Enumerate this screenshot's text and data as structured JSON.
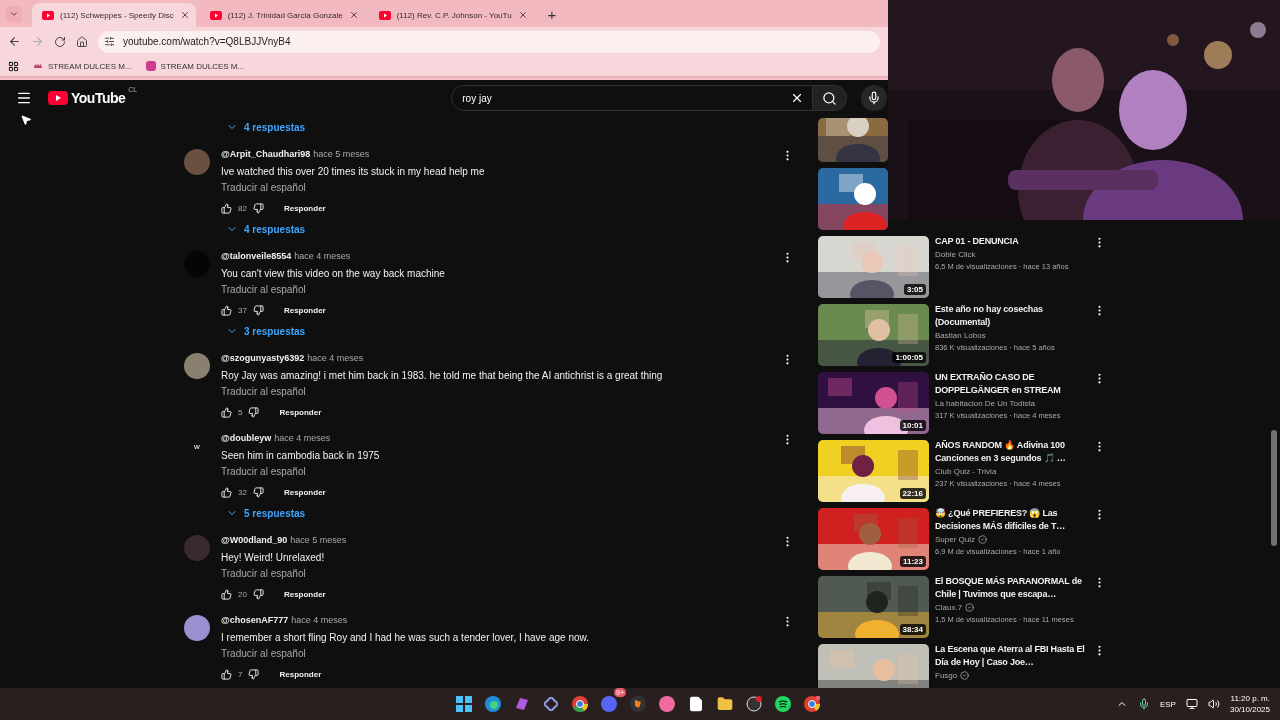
{
  "browser": {
    "tabs": [
      {
        "title": "(112) Schweppes - Speedy Disc",
        "selected": true
      },
      {
        "title": "(112) J. Trinidad Garcia Gonzale",
        "selected": false
      },
      {
        "title": "(112) Rev. C.P. Johnson - YouTu",
        "selected": false
      }
    ],
    "new_tab": "+",
    "url": "youtube.com/watch?v=Q8LBJJVnyB4",
    "bookmarks": [
      "STREAM DULCES M...",
      "STREAM DULCES M..."
    ]
  },
  "header": {
    "logo": "YouTube",
    "country": "CL",
    "search": {
      "value": "roy jay"
    }
  },
  "comments": {
    "top_replies": "4 respuestas",
    "items": [
      {
        "author": "@Arpit_Chaudhari98",
        "time": "hace 5 meses",
        "text": "Ive watched this over 20 times its stuck in my head help me",
        "translate": "Traducir al español",
        "likes": "82",
        "reply": "Responder",
        "replies": "4 respuestas"
      },
      {
        "author": "@talonveile8554",
        "time": "hace 4 meses",
        "text": "You can't view this video on the way back machine",
        "translate": "Traducir al español",
        "likes": "37",
        "reply": "Responder",
        "replies": "3 respuestas"
      },
      {
        "author": "@szogunyasty6392",
        "time": "hace 4 meses",
        "text": "Roy Jay was amazing! i met him back in 1983. he told me that being the AI antichrist is a great thing",
        "translate": "Traducir al español",
        "likes": "5",
        "reply": "Responder"
      },
      {
        "author": "@doubleyw",
        "avatar_letter": "w",
        "time": "hace 4 meses",
        "text": "Seen him in cambodia back in 1975",
        "translate": "Traducir al español",
        "likes": "32",
        "reply": "Responder",
        "replies": "5 respuestas"
      },
      {
        "author": "@W00dland_90",
        "time": "hace 5 meses",
        "text": "Hey! Weird! Unrelaxed!",
        "translate": "Traducir al español",
        "likes": "20",
        "reply": "Responder"
      },
      {
        "author": "@chosenAF777",
        "time": "hace 4 meses",
        "text": "I remember a short fling Roy and I had he was such a tender lover, I have age now.",
        "translate": "Traducir al español",
        "likes": "7",
        "reply": "Responder"
      }
    ]
  },
  "sidebar": {
    "items": [
      {
        "kind": "partial"
      },
      {
        "kind": "partial"
      },
      {
        "kind": "video",
        "title": "CAP 01 - DENUNCIA",
        "channel": "Doble Click",
        "verified": false,
        "stats": "6,5 M de visualizaciones · hace 13 años",
        "duration": "3:05"
      },
      {
        "kind": "video",
        "title": "Este año no hay cosechas (Documental)",
        "channel": "Bastian Lobos",
        "verified": false,
        "stats": "836 K visualizaciones · hace 5 años",
        "duration": "1:00:05"
      },
      {
        "kind": "video",
        "title": "UN EXTRAÑO CASO DE DOPPELGÄNGER en STREAM",
        "channel": "La habitacion De Un Todista",
        "verified": false,
        "stats": "317 K visualizaciones · hace 4 meses",
        "duration": "10:01"
      },
      {
        "kind": "video",
        "title": "AÑOS RANDOM 🔥 Adivina 100 Canciones en 3 segundos 🎵 …",
        "channel": "Club Quiz - Trivia",
        "verified": false,
        "stats": "237 K visualizaciones · hace 4 meses",
        "duration": "22:16"
      },
      {
        "kind": "video",
        "title": "🤯 ¿Qué PREFIERES? 😱 Las Decisiones MÁS difíciles de T…",
        "channel": "Super Quiz",
        "verified": true,
        "stats": "6,9 M de visualizaciones · hace 1 año",
        "duration": "11:23"
      },
      {
        "kind": "video",
        "title": "El BOSQUE MÁS PARANORMAL de Chile | Tuvimos que escapa…",
        "channel": "Claux.7",
        "verified": true,
        "stats": "1,5 M de visualizaciones · hace 11 meses",
        "duration": "38:34"
      },
      {
        "kind": "video",
        "title": "La Escena que Aterra al FBI Hasta El Día de Hoy | Caso Joe…",
        "channel": "Fusgo",
        "verified": true
      }
    ]
  },
  "taskbar": {
    "chat_badge": "9+",
    "language": "ESP",
    "time": "11:20 p. m.",
    "date": "30/10/2025"
  }
}
